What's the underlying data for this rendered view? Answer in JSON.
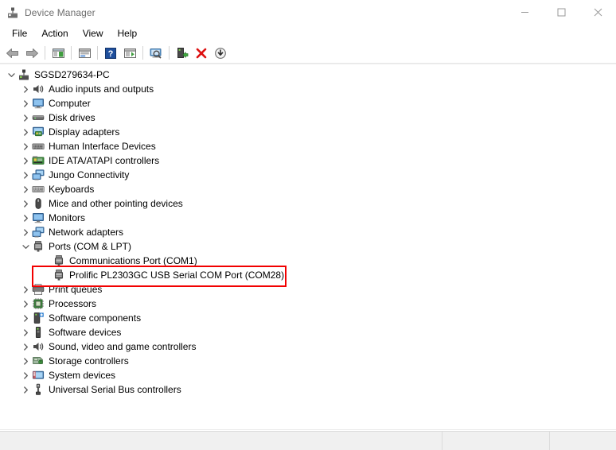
{
  "window": {
    "title": "Device Manager",
    "title_icon": "device-manager-icon",
    "minimize_label": "Minimize",
    "maximize_label": "Maximize",
    "close_label": "Close"
  },
  "menubar": {
    "items": [
      {
        "label": "File"
      },
      {
        "label": "Action"
      },
      {
        "label": "View"
      },
      {
        "label": "Help"
      }
    ]
  },
  "toolbar": {
    "buttons": [
      {
        "name": "back-arrow-icon",
        "tip": "Back"
      },
      {
        "name": "forward-arrow-icon",
        "tip": "Forward"
      },
      {
        "name": "separator-1",
        "tip": ""
      },
      {
        "name": "show-hide-console-tree-icon",
        "tip": "Show/Hide Console Tree"
      },
      {
        "name": "separator-2",
        "tip": ""
      },
      {
        "name": "properties-icon",
        "tip": "Properties"
      },
      {
        "name": "separator-3",
        "tip": ""
      },
      {
        "name": "help-icon",
        "tip": "Help"
      },
      {
        "name": "action-pane-icon",
        "tip": "Show Action Pane"
      },
      {
        "name": "separator-4",
        "tip": ""
      },
      {
        "name": "scan-hardware-changes-icon",
        "tip": "Scan for hardware changes"
      },
      {
        "name": "separator-5",
        "tip": ""
      },
      {
        "name": "update-driver-icon",
        "tip": "Update Driver Software"
      },
      {
        "name": "uninstall-device-icon",
        "tip": "Uninstall device"
      },
      {
        "name": "disable-device-icon",
        "tip": "Disable device"
      }
    ]
  },
  "tree": {
    "root": {
      "label": "SGSD279634-PC",
      "icon": "computer-root-icon",
      "expanded": true
    },
    "nodes": [
      {
        "label": "Audio inputs and outputs",
        "icon": "speaker-icon",
        "level": 1,
        "expanded": false
      },
      {
        "label": "Computer",
        "icon": "monitor-icon",
        "level": 1,
        "expanded": false
      },
      {
        "label": "Disk drives",
        "icon": "disk-drive-icon",
        "level": 1,
        "expanded": false
      },
      {
        "label": "Display adapters",
        "icon": "display-adapter-icon",
        "level": 1,
        "expanded": false
      },
      {
        "label": "Human Interface Devices",
        "icon": "hid-icon",
        "level": 1,
        "expanded": false
      },
      {
        "label": "IDE ATA/ATAPI controllers",
        "icon": "ide-controller-icon",
        "level": 1,
        "expanded": false
      },
      {
        "label": "Jungo Connectivity",
        "icon": "network-stack-icon",
        "level": 1,
        "expanded": false
      },
      {
        "label": "Keyboards",
        "icon": "keyboard-icon",
        "level": 1,
        "expanded": false
      },
      {
        "label": "Mice and other pointing devices",
        "icon": "mouse-icon",
        "level": 1,
        "expanded": false
      },
      {
        "label": "Monitors",
        "icon": "monitor-icon",
        "level": 1,
        "expanded": false
      },
      {
        "label": "Network adapters",
        "icon": "network-stack-icon",
        "level": 1,
        "expanded": false
      },
      {
        "label": "Ports (COM & LPT)",
        "icon": "port-icon",
        "level": 1,
        "expanded": true
      },
      {
        "label": "Communications Port (COM1)",
        "icon": "port-icon",
        "level": 2,
        "expanded": null
      },
      {
        "label": "Prolific PL2303GC USB Serial COM Port (COM28)",
        "icon": "port-icon",
        "level": 2,
        "expanded": null,
        "highlighted": true
      },
      {
        "label": "Print queues",
        "icon": "printer-icon",
        "level": 1,
        "expanded": false
      },
      {
        "label": "Processors",
        "icon": "processor-icon",
        "level": 1,
        "expanded": false
      },
      {
        "label": "Software components",
        "icon": "software-component-icon",
        "level": 1,
        "expanded": false
      },
      {
        "label": "Software devices",
        "icon": "software-device-icon",
        "level": 1,
        "expanded": false
      },
      {
        "label": "Sound, video and game controllers",
        "icon": "speaker-icon",
        "level": 1,
        "expanded": false
      },
      {
        "label": "Storage controllers",
        "icon": "storage-controller-icon",
        "level": 1,
        "expanded": false
      },
      {
        "label": "System devices",
        "icon": "system-device-icon",
        "level": 1,
        "expanded": false
      },
      {
        "label": "Universal Serial Bus controllers",
        "icon": "usb-icon",
        "level": 1,
        "expanded": false
      }
    ]
  },
  "annotation": {
    "color": "#f20000",
    "target_label": "Prolific PL2303GC USB Serial COM Port (COM28)"
  },
  "statusbar": {
    "pane_main": "",
    "pane_2": "",
    "pane_3": ""
  },
  "colors": {
    "title_text": "#6d6d6d",
    "body_text": "#000000",
    "window_bg": "#ffffff",
    "statusbar_bg": "#f0f0f0",
    "annotation_red": "#f20000",
    "hover_blue": "#e5f3fb"
  }
}
